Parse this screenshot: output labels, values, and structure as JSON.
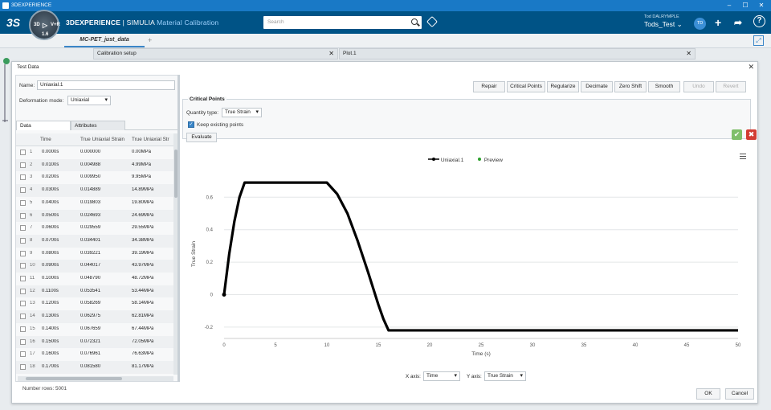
{
  "window": {
    "title": "3DEXPERIENCE"
  },
  "appbar": {
    "brand_bold": "3DEXPERIENCE",
    "brand_sep": " | ",
    "brand_product": "SIMULIA",
    "brand_app": " Material Calibration",
    "compass_label": "1.6",
    "search_placeholder": "Search",
    "user_name": "Tod DALRYMPLE",
    "tenant": "Tods_Test",
    "avatar_initials": "TD"
  },
  "tabs": {
    "active": "MC-PET_just_data"
  },
  "panels": {
    "calibration_setup": "Calibration setup",
    "plot": "Plot.1",
    "left_label": "MC-PET_just_data"
  },
  "dialog": {
    "title": "Test Data",
    "name_label": "Name:",
    "name_value": "Uniaxial.1",
    "deformation_label": "Deformation mode:",
    "deformation_value": "Uniaxial",
    "subtabs": [
      "Data",
      "Attributes"
    ],
    "columns": [
      "Time",
      "True Uniaxial Strain",
      "True Uniaxial Str"
    ],
    "rows": [
      [
        "1",
        "0.0000s",
        "0.000000",
        "0.00MPa"
      ],
      [
        "2",
        "0.0100s",
        "0.004988",
        "4.99MPa"
      ],
      [
        "3",
        "0.0200s",
        "0.009950",
        "9.95MPa"
      ],
      [
        "4",
        "0.0300s",
        "0.014889",
        "14.89MPa"
      ],
      [
        "5",
        "0.0400s",
        "0.019803",
        "19.80MPa"
      ],
      [
        "6",
        "0.0500s",
        "0.024693",
        "24.69MPa"
      ],
      [
        "7",
        "0.0600s",
        "0.029559",
        "29.55MPa"
      ],
      [
        "8",
        "0.0700s",
        "0.034401",
        "34.38MPa"
      ],
      [
        "9",
        "0.0800s",
        "0.039221",
        "39.19MPa"
      ],
      [
        "10",
        "0.0900s",
        "0.044017",
        "43.97MPa"
      ],
      [
        "11",
        "0.1000s",
        "0.048790",
        "48.72MPa"
      ],
      [
        "12",
        "0.1100s",
        "0.053541",
        "53.44MPa"
      ],
      [
        "13",
        "0.1200s",
        "0.058269",
        "58.14MPa"
      ],
      [
        "14",
        "0.1300s",
        "0.062975",
        "62.81MPa"
      ],
      [
        "15",
        "0.1400s",
        "0.067659",
        "67.44MPa"
      ],
      [
        "16",
        "0.1500s",
        "0.072321",
        "72.05MPa"
      ],
      [
        "17",
        "0.1600s",
        "0.076961",
        "76.63MPa"
      ],
      [
        "18",
        "0.1700s",
        "0.081580",
        "81.17MPa"
      ]
    ],
    "number_rows": "Number rows: 5001",
    "toolbar": [
      "Repair",
      "Critical Points",
      "Regularize",
      "Decimate",
      "Zero Shift",
      "Smooth"
    ],
    "undo": "Undo",
    "revert": "Revert",
    "critical_points_title": "Critical Points",
    "quantity_type_label": "Quantity type:",
    "quantity_type_value": "True Strain",
    "keep_existing_label": "Keep existing points",
    "evaluate_label": "Evaluate",
    "x_axis_label": "X axis:",
    "x_axis_value": "Time",
    "y_axis_label": "Y axis:",
    "y_axis_value": "True Strain",
    "ok_label": "OK",
    "cancel_label": "Cancel"
  },
  "colors": {
    "accent": "#005386",
    "titlebar": "#1979c6",
    "series": "#000000",
    "preview": "#2ca02c"
  },
  "chart_data": {
    "type": "line",
    "title": "",
    "xlabel": "Time (s)",
    "ylabel": "True Strain",
    "xlim": [
      0,
      50
    ],
    "ylim": [
      -0.25,
      0.75
    ],
    "xticks": [
      0,
      5,
      10,
      15,
      20,
      25,
      30,
      35,
      40,
      45,
      50
    ],
    "yticks": [
      -0.2,
      0,
      0.2,
      0.4,
      0.6
    ],
    "grid": "horizontal",
    "legend": "top-center",
    "series": [
      {
        "name": "Uniaxial.1",
        "x": [
          0,
          0.5,
          1,
          1.5,
          2,
          10,
          11,
          12,
          13,
          14,
          15,
          15.5,
          16,
          50
        ],
        "y": [
          0,
          0.25,
          0.45,
          0.6,
          0.69,
          0.69,
          0.62,
          0.5,
          0.33,
          0.14,
          -0.06,
          -0.15,
          -0.22,
          -0.22
        ]
      },
      {
        "name": "Preview",
        "x": [],
        "y": []
      }
    ]
  }
}
